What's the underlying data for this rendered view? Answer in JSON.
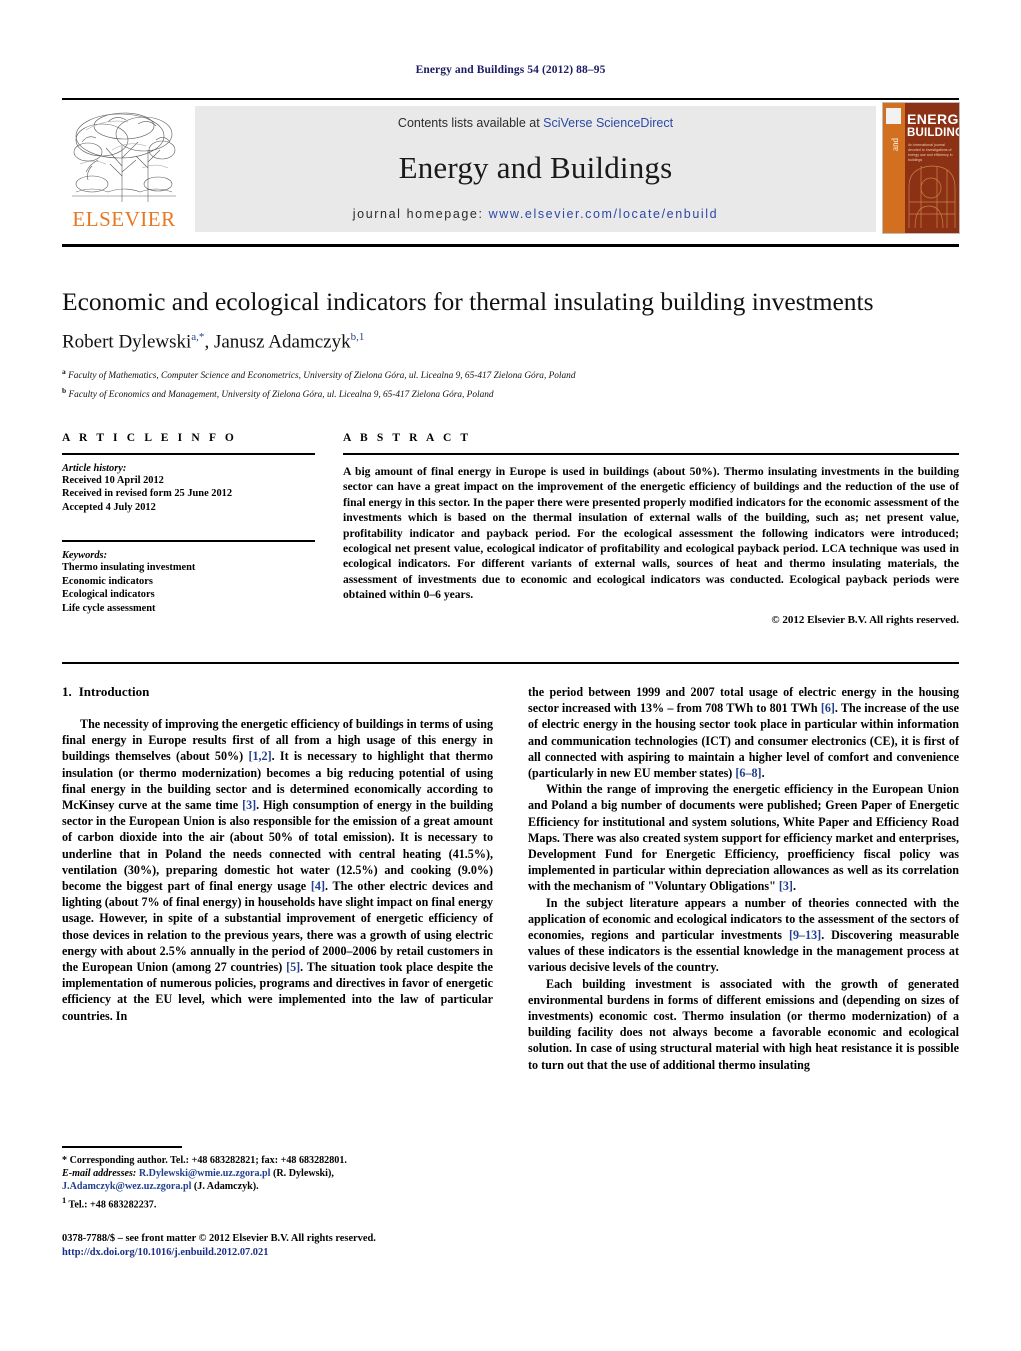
{
  "running_head": "Energy and Buildings 54 (2012) 88–95",
  "masthead": {
    "publisher_logo_text": "ELSEVIER",
    "contents_prefix": "Contents lists available at ",
    "contents_link": "SciVerse ScienceDirect",
    "journal_name": "Energy and Buildings",
    "homepage_prefix": "journal homepage: ",
    "homepage_url": "www.elsevier.com/locate/enbuild",
    "cover": {
      "title_line1": "ENERGY",
      "title_line2": "BUILDINGS",
      "and_word": "and",
      "subtitle": "An international journal devoted to investigations of energy use and efficiency in buildings",
      "strip_color": "#d2701f",
      "panel_color": "#8c3114"
    }
  },
  "article": {
    "title": "Economic and ecological indicators for thermal insulating building investments",
    "authors": [
      {
        "name": "Robert Dylewski",
        "marks": "a,*"
      },
      {
        "name": "Janusz Adamczyk",
        "marks": "b,1"
      }
    ],
    "authors_separator": ", ",
    "affiliations": [
      {
        "mark": "a",
        "text": "Faculty of Mathematics, Computer Science and Econometrics, University of Zielona Góra, ul. Licealna 9, 65-417 Zielona Góra, Poland"
      },
      {
        "mark": "b",
        "text": "Faculty of Economics and Management, University of Zielona Góra, ul. Licealna 9, 65-417 Zielona Góra, Poland"
      }
    ]
  },
  "article_info": {
    "heading": "A R T I C L E  I N F O",
    "history_heading": "Article history:",
    "history": [
      "Received 10 April 2012",
      "Received in revised form 25 June 2012",
      "Accepted 4 July 2012"
    ],
    "keywords_heading": "Keywords:",
    "keywords": [
      "Thermo insulating investment",
      "Economic indicators",
      "Ecological indicators",
      "Life cycle assessment"
    ]
  },
  "abstract": {
    "heading": "A B S T R A C T",
    "text": "A big amount of final energy in Europe is used in buildings (about 50%). Thermo insulating investments in the building sector can have a great impact on the improvement of the energetic efficiency of buildings and the reduction of the use of final energy in this sector. In the paper there were presented properly modified indicators for the economic assessment of the investments which is based on the thermal insulation of external walls of the building, such as; net present value, profitability indicator and payback period. For the ecological assessment the following indicators were introduced; ecological net present value, ecological indicator of profitability and ecological payback period. LCA technique was used in ecological indicators. For different variants of external walls, sources of heat and thermo insulating materials, the assessment of investments due to economic and ecological indicators was conducted. Ecological payback periods were obtained within 0–6 years.",
    "copyright": "© 2012 Elsevier B.V. All rights reserved."
  },
  "body": {
    "section_number": "1.",
    "section_title": "Introduction",
    "left_paragraphs": [
      {
        "segments": [
          {
            "t": "The necessity of improving the energetic efficiency of buildings in terms of using final energy in Europe results first of all from a high usage of this energy in buildings themselves (about 50%) "
          },
          {
            "t": "[1,2]",
            "ref": true
          },
          {
            "t": ". It is necessary to highlight that thermo insulation (or thermo modernization) becomes a big reducing potential of using final energy in the building sector and is determined economically according to McKinsey curve at the same time "
          },
          {
            "t": "[3]",
            "ref": true
          },
          {
            "t": ". High consumption of energy in the building sector in the European Union is also responsible for the emission of a great amount of carbon dioxide into the air (about 50% of total emission). It is necessary to underline that in Poland the needs connected with central heating (41.5%), ventilation (30%), preparing domestic hot water (12.5%) and cooking (9.0%) become the biggest part of final energy usage "
          },
          {
            "t": "[4]",
            "ref": true
          },
          {
            "t": ". The other electric devices and lighting (about 7% of final energy) in households have slight impact on final energy usage. However, in spite of a substantial improvement of energetic efficiency of those devices in relation to the previous years, there was a growth of using electric energy with about 2.5% annually in the period of 2000–2006 by retail customers in the European Union (among 27 countries) "
          },
          {
            "t": "[5]",
            "ref": true
          },
          {
            "t": ". The situation took place despite the implementation of numerous policies, programs and directives in favor of energetic efficiency at the EU level, which were implemented into the law of particular countries. In"
          }
        ]
      }
    ],
    "right_paragraphs": [
      {
        "indent": false,
        "segments": [
          {
            "t": "the period between 1999 and 2007 total usage of electric energy in the housing sector increased with 13% – from 708 TWh to 801 TWh "
          },
          {
            "t": "[6]",
            "ref": true
          },
          {
            "t": ". The increase of the use of electric energy in the housing sector took place in particular within information and communication technologies (ICT) and consumer electronics (CE), it is first of all connected with aspiring to maintain a higher level of comfort and convenience (particularly in new EU member states) "
          },
          {
            "t": "[6–8]",
            "ref": true
          },
          {
            "t": "."
          }
        ]
      },
      {
        "indent": true,
        "segments": [
          {
            "t": "Within the range of improving the energetic efficiency in the European Union and Poland a big number of documents were published; Green Paper of Energetic Efficiency for institutional and system solutions, White Paper and Efficiency Road Maps. There was also created system support for efficiency market and enterprises, Development Fund for Energetic Efficiency, proefficiency fiscal policy was implemented in particular within depreciation allowances as well as its correlation with the mechanism of \"Voluntary Obligations\" "
          },
          {
            "t": "[3]",
            "ref": true
          },
          {
            "t": "."
          }
        ]
      },
      {
        "indent": true,
        "segments": [
          {
            "t": "In the subject literature appears a number of theories connected with the application of economic and ecological indicators to the assessment of the sectors of economies, regions and particular investments "
          },
          {
            "t": "[9–13]",
            "ref": true
          },
          {
            "t": ". Discovering measurable values of these indicators is the essential knowledge in the management process at various decisive levels of the country."
          }
        ]
      },
      {
        "indent": true,
        "segments": [
          {
            "t": "Each building investment is associated with the growth of generated environmental burdens in forms of different emissions and (depending on sizes of investments) economic cost. Thermo insulation (or thermo modernization) of a building facility does not always become a favorable economic and ecological solution. In case of using structural material with high heat resistance it is possible to turn out that the use of additional thermo insulating"
          }
        ]
      }
    ]
  },
  "footnotes": {
    "corresponding": "* Corresponding author. Tel.: +48 683282821; fax: +48 683282801.",
    "email_label": "E-mail addresses:",
    "email1": "R.Dylewski@wmie.uz.zgora.pl",
    "email1_owner": "(R. Dylewski),",
    "email2": "J.Adamczyk@wez.uz.zgora.pl",
    "email2_owner": "(J. Adamczyk).",
    "note1_mark": "1",
    "note1": "Tel.: +48 683282237."
  },
  "imprint": {
    "issn_line": "0378-7788/$ – see front matter © 2012 Elsevier B.V. All rights reserved.",
    "doi": "http://dx.doi.org/10.1016/j.enbuild.2012.07.021"
  }
}
